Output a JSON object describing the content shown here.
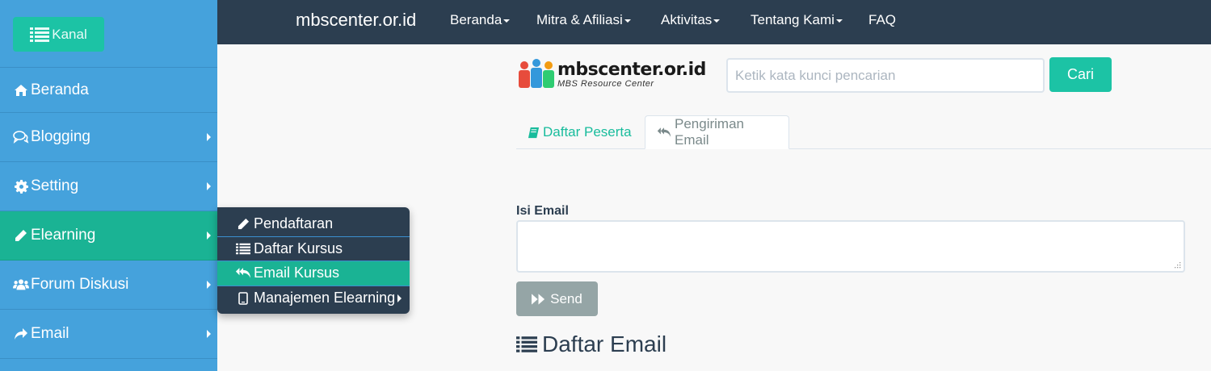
{
  "sidebar": {
    "kanal_label": "Kanal",
    "items": [
      {
        "label": "Beranda",
        "icon": "home-icon",
        "has_submenu": false
      },
      {
        "label": "Blogging",
        "icon": "comments-icon",
        "has_submenu": true
      },
      {
        "label": "Setting",
        "icon": "gear-icon",
        "has_submenu": true
      },
      {
        "label": "Elearning",
        "icon": "pencil-icon",
        "has_submenu": true,
        "active": true
      },
      {
        "label": "Forum Diskusi",
        "icon": "users-icon",
        "has_submenu": true
      },
      {
        "label": "Email",
        "icon": "share-icon",
        "has_submenu": true
      }
    ]
  },
  "topnav": {
    "brand": "mbscenter.or.id",
    "items": [
      {
        "label": "Beranda"
      },
      {
        "label": "Mitra & Afiliasi"
      },
      {
        "label": "Aktivitas"
      },
      {
        "label": "Tentang Kami"
      },
      {
        "label": "FAQ"
      }
    ]
  },
  "submenu": {
    "items": [
      {
        "label": "Pendaftaran",
        "icon": "pencil-icon"
      },
      {
        "label": "Daftar Kursus",
        "icon": "list-icon"
      },
      {
        "label": "Email Kursus",
        "icon": "reply-all-icon",
        "active": true
      },
      {
        "label": "Manajemen Elearning",
        "icon": "tablet-icon",
        "has_submenu": true
      }
    ]
  },
  "logo": {
    "text": "mbscenter.or.id",
    "subtext": "MBS Resource Center"
  },
  "search": {
    "placeholder": "Ketik kata kunci pencarian",
    "value": "",
    "button_label": "Cari"
  },
  "tabs": [
    {
      "label": "Daftar Peserta",
      "icon": "book-icon"
    },
    {
      "label": "Pengiriman Email",
      "icon": "reply-all-icon",
      "active": true
    }
  ],
  "form": {
    "isi_email_label": "Isi Email",
    "isi_email_value": "",
    "send_label": "Send"
  },
  "section": {
    "daftar_email_title": "Daftar Email"
  },
  "colors": {
    "sidebar_bg": "#45a2dc",
    "navbar_bg": "#2c3e50",
    "accent_teal": "#1cc3a5",
    "active_green": "#1ab394",
    "send_button": "#95a5a6"
  }
}
